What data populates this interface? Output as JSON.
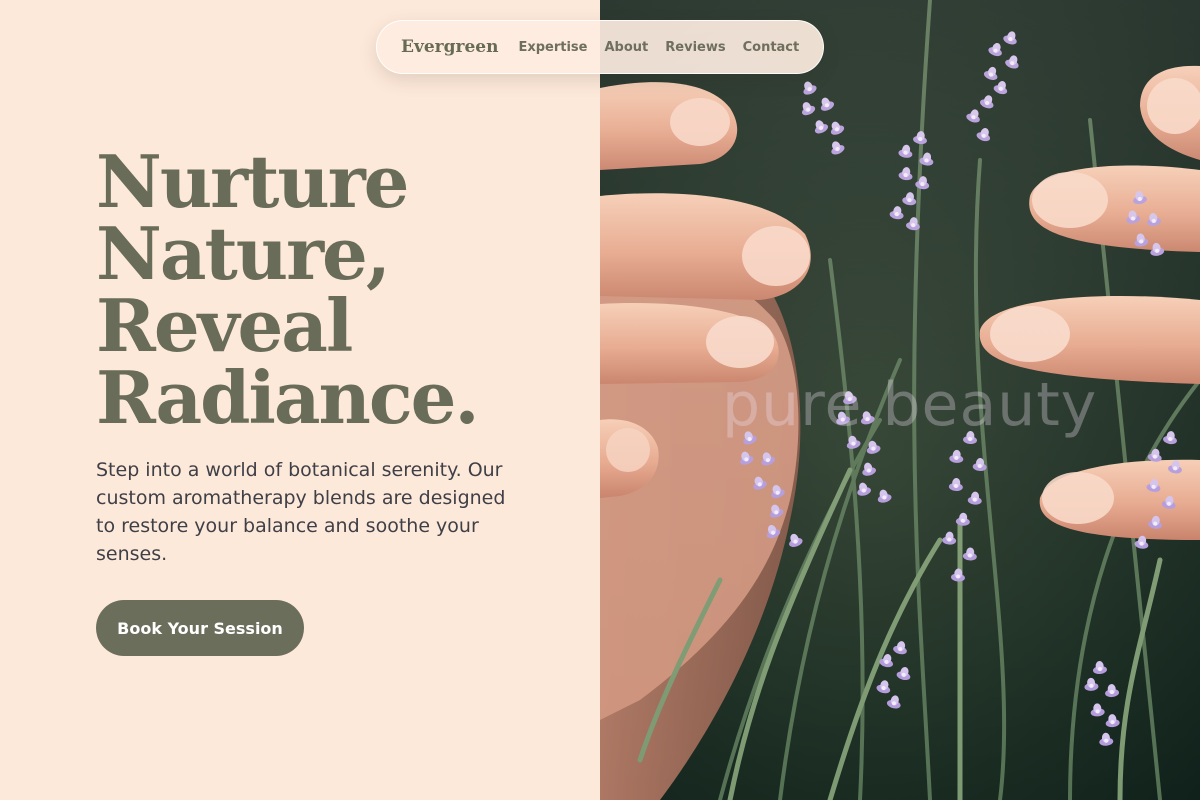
{
  "nav": {
    "brand": "Evergreen",
    "links": [
      "Expertise",
      "About",
      "Reviews",
      "Contact"
    ]
  },
  "hero": {
    "title_lines": [
      "Nurture",
      "Nature,",
      "Reveal",
      "Radiance."
    ],
    "description": "Step into a world of botanical serenity. Our custom aromatherapy blends are designed to restore your balance and soothe your senses.",
    "cta_label": "Book Your Session"
  },
  "image": {
    "subject": "hands-among-lavender-photo",
    "watermark_text": "pure beauty"
  },
  "colors": {
    "page_background": "#fde9da",
    "accent_olive": "#686c58",
    "button_background": "#6b6e5b",
    "button_text": "#ffffff",
    "body_text": "#3f3f47",
    "lavender": "#a58fd1"
  }
}
